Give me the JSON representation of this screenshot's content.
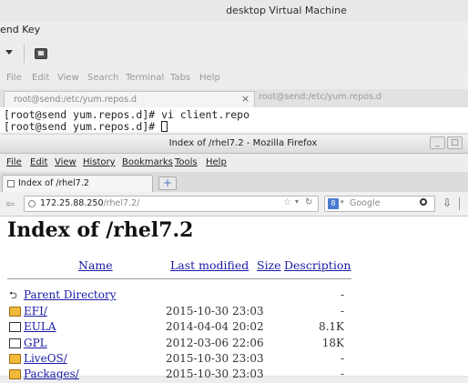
{
  "vm": {
    "title": "desktop Virtual Machine",
    "menu_label": "end Key"
  },
  "terminal": {
    "menu": [
      "File",
      "Edit",
      "View",
      "Search",
      "Terminal",
      "Tabs",
      "Help"
    ],
    "tabs": [
      {
        "label": "root@send:/etc/yum.repos.d",
        "active": true
      },
      {
        "label": "root@send:/etc/yum.repos.d",
        "active": false
      }
    ],
    "close_glyph": "×",
    "lines": [
      "[root@send yum.repos.d]# vi client.repo",
      "[root@send yum.repos.d]# "
    ]
  },
  "firefox": {
    "title": "Index of /rhel7.2 - Mozilla Firefox",
    "window_buttons": [
      "_",
      "□"
    ],
    "menu": [
      "File",
      "Edit",
      "View",
      "History",
      "Bookmarks",
      "Tools",
      "Help"
    ],
    "tab_label": "Index of /rhel7.2",
    "new_tab_glyph": "+",
    "url_host": "172.25.88.250",
    "url_path": "/rhel7.2/",
    "search_placeholder": "Google",
    "search_engine_badge": "8",
    "back_glyph": "⇦"
  },
  "page": {
    "heading": "Index of /rhel7.2",
    "columns": {
      "name": "Name",
      "last_modified": "Last modified",
      "size": "Size",
      "description": "Description"
    },
    "rows": [
      {
        "name": "Parent Directory",
        "date": "",
        "size": "-",
        "icon": "back-arrow-icon"
      },
      {
        "name": "EFI/",
        "date": "2015-10-30 23:03",
        "size": "-",
        "icon": "folder-icon"
      },
      {
        "name": "EULA",
        "date": "2014-04-04 20:02",
        "size": "8.1K",
        "icon": "document-icon"
      },
      {
        "name": "GPL",
        "date": "2012-03-06 22:06",
        "size": "18K",
        "icon": "document-icon"
      },
      {
        "name": "LiveOS/",
        "date": "2015-10-30 23:03",
        "size": "-",
        "icon": "folder-icon"
      },
      {
        "name": "Packages/",
        "date": "2015-10-30 23:03",
        "size": "-",
        "icon": "folder-icon"
      }
    ]
  },
  "colors": {
    "link": "#1a1aa6",
    "folder": "#f0b93a"
  }
}
